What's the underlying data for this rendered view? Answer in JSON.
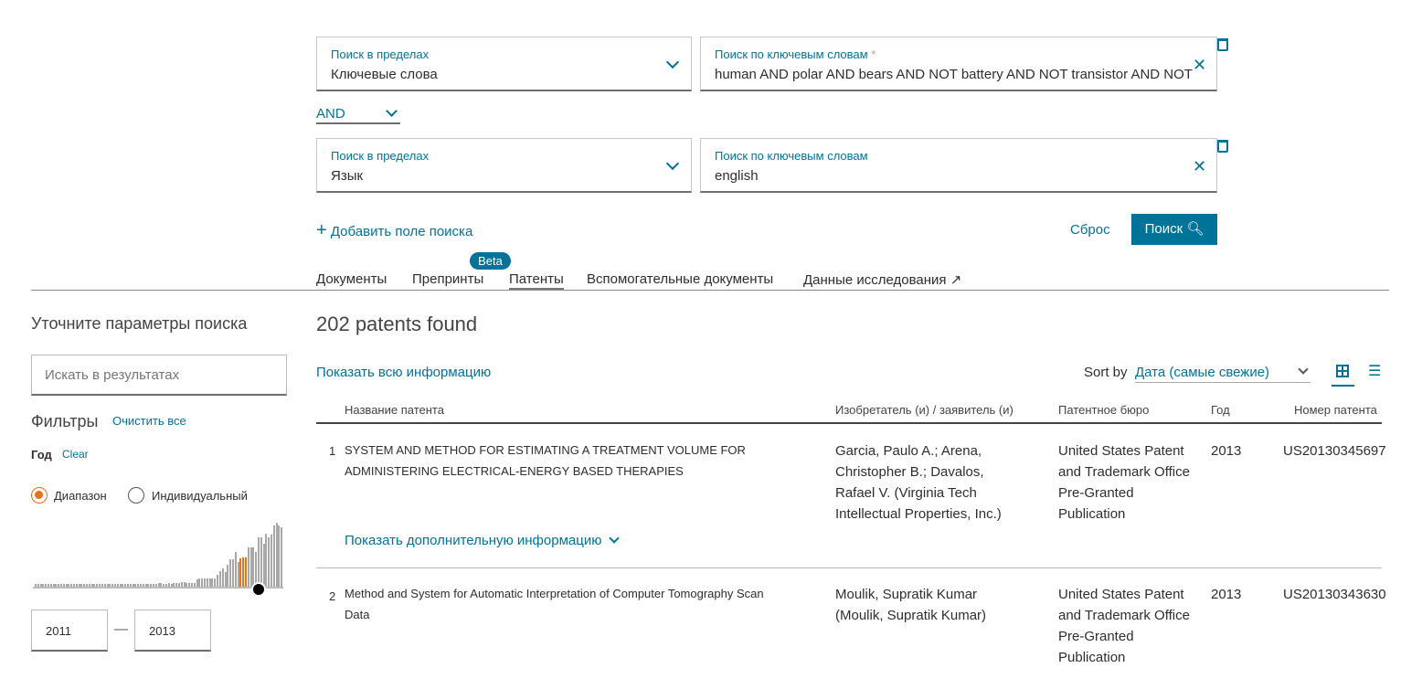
{
  "query": {
    "rows": [
      {
        "scope_label": "Поиск в пределах",
        "scope_value": "Ключевые слова",
        "kw_label": "Поиск по ключевым словам",
        "required_mark": "*",
        "kw_value": "human AND polar AND bears AND NOT battery AND NOT transistor AND NOT"
      },
      {
        "scope_label": "Поиск в пределах",
        "scope_value": "Язык",
        "kw_label": "Поиск по ключевым словам",
        "kw_value": "english"
      }
    ],
    "operator": "AND",
    "add_field": "Добавить поле поиска",
    "reset": "Сброс",
    "search": "Поиск"
  },
  "tabs": [
    {
      "label": "Документы"
    },
    {
      "label": "Препринты",
      "badge": "Beta"
    },
    {
      "label": "Патенты",
      "active": true
    },
    {
      "label": "Вспомогательные документы"
    },
    {
      "label": "Данные исследования ↗"
    }
  ],
  "sidebar": {
    "title": "Уточните параметры поиска",
    "search_placeholder": "Искать в результатах",
    "filters": "Фильтры",
    "clear_all": "Очистить все",
    "year": "Год",
    "clear": "Clear",
    "range": "Диапазон",
    "individual": "Индивидуальный",
    "range_selected": "range",
    "from": "2011",
    "to": "2013",
    "dash": "—",
    "histogram": [
      2,
      2,
      2,
      2,
      2,
      2,
      2,
      2,
      2,
      2,
      2,
      2,
      2,
      2,
      2,
      2,
      2,
      2,
      2,
      2,
      2,
      2,
      2,
      2,
      2,
      2,
      2,
      2,
      2,
      2,
      2,
      2,
      2,
      2,
      2,
      2,
      2,
      2,
      2,
      2,
      2,
      2,
      2,
      2,
      2,
      2,
      2,
      2,
      3,
      3,
      2,
      2,
      3,
      2,
      3,
      3,
      3,
      4,
      4,
      3,
      3,
      3,
      3,
      6,
      7,
      7,
      7,
      7,
      7,
      7,
      7,
      10,
      13,
      15,
      12,
      18,
      22,
      22,
      28,
      20,
      23,
      24,
      24,
      32,
      32,
      32,
      28,
      40,
      40,
      35,
      43,
      40,
      42,
      50,
      52,
      50,
      48
    ],
    "histogram_selected": [
      80,
      81,
      82
    ],
    "colors": {
      "bar": "#a8a8a8",
      "selected": "#e9711c"
    }
  },
  "results": {
    "count": "202 patents found",
    "show_all": "Показать всю информацию",
    "sort_by": "Sort by",
    "sort_value": "Дата (самые свежие)",
    "columns": [
      "Название патента",
      "Изобретатель (и) / заявитель (и)",
      "Патентное бюро",
      "Год",
      "Номер патента"
    ],
    "rows": [
      {
        "n": "1",
        "title": "SYSTEM AND METHOD FOR ESTIMATING A TREATMENT VOLUME FOR ADMINISTERING ELECTRICAL-ENERGY BASED THERAPIES",
        "inventor": "Garcia, Paulo A.; Arena, Christopher B.; Davalos, Rafael V. (Virginia Tech Intellectual Properties, Inc.)",
        "office": "United States Patent and Trademark Office Pre-Granted Publication",
        "year": "2013",
        "number": "US20130345697",
        "more": "Показать дополнительную информацию"
      },
      {
        "n": "2",
        "title": "Method and System for Automatic Interpretation of Computer Tomography Scan Data",
        "inventor": "Moulik, Supratik Kumar (Moulik, Supratik Kumar)",
        "office": "United States Patent and Trademark Office Pre-Granted Publication",
        "year": "2013",
        "number": "US20130343630"
      }
    ]
  },
  "colors": {
    "accent": "#007398",
    "button": "#007398",
    "orange": "#e9711c"
  }
}
